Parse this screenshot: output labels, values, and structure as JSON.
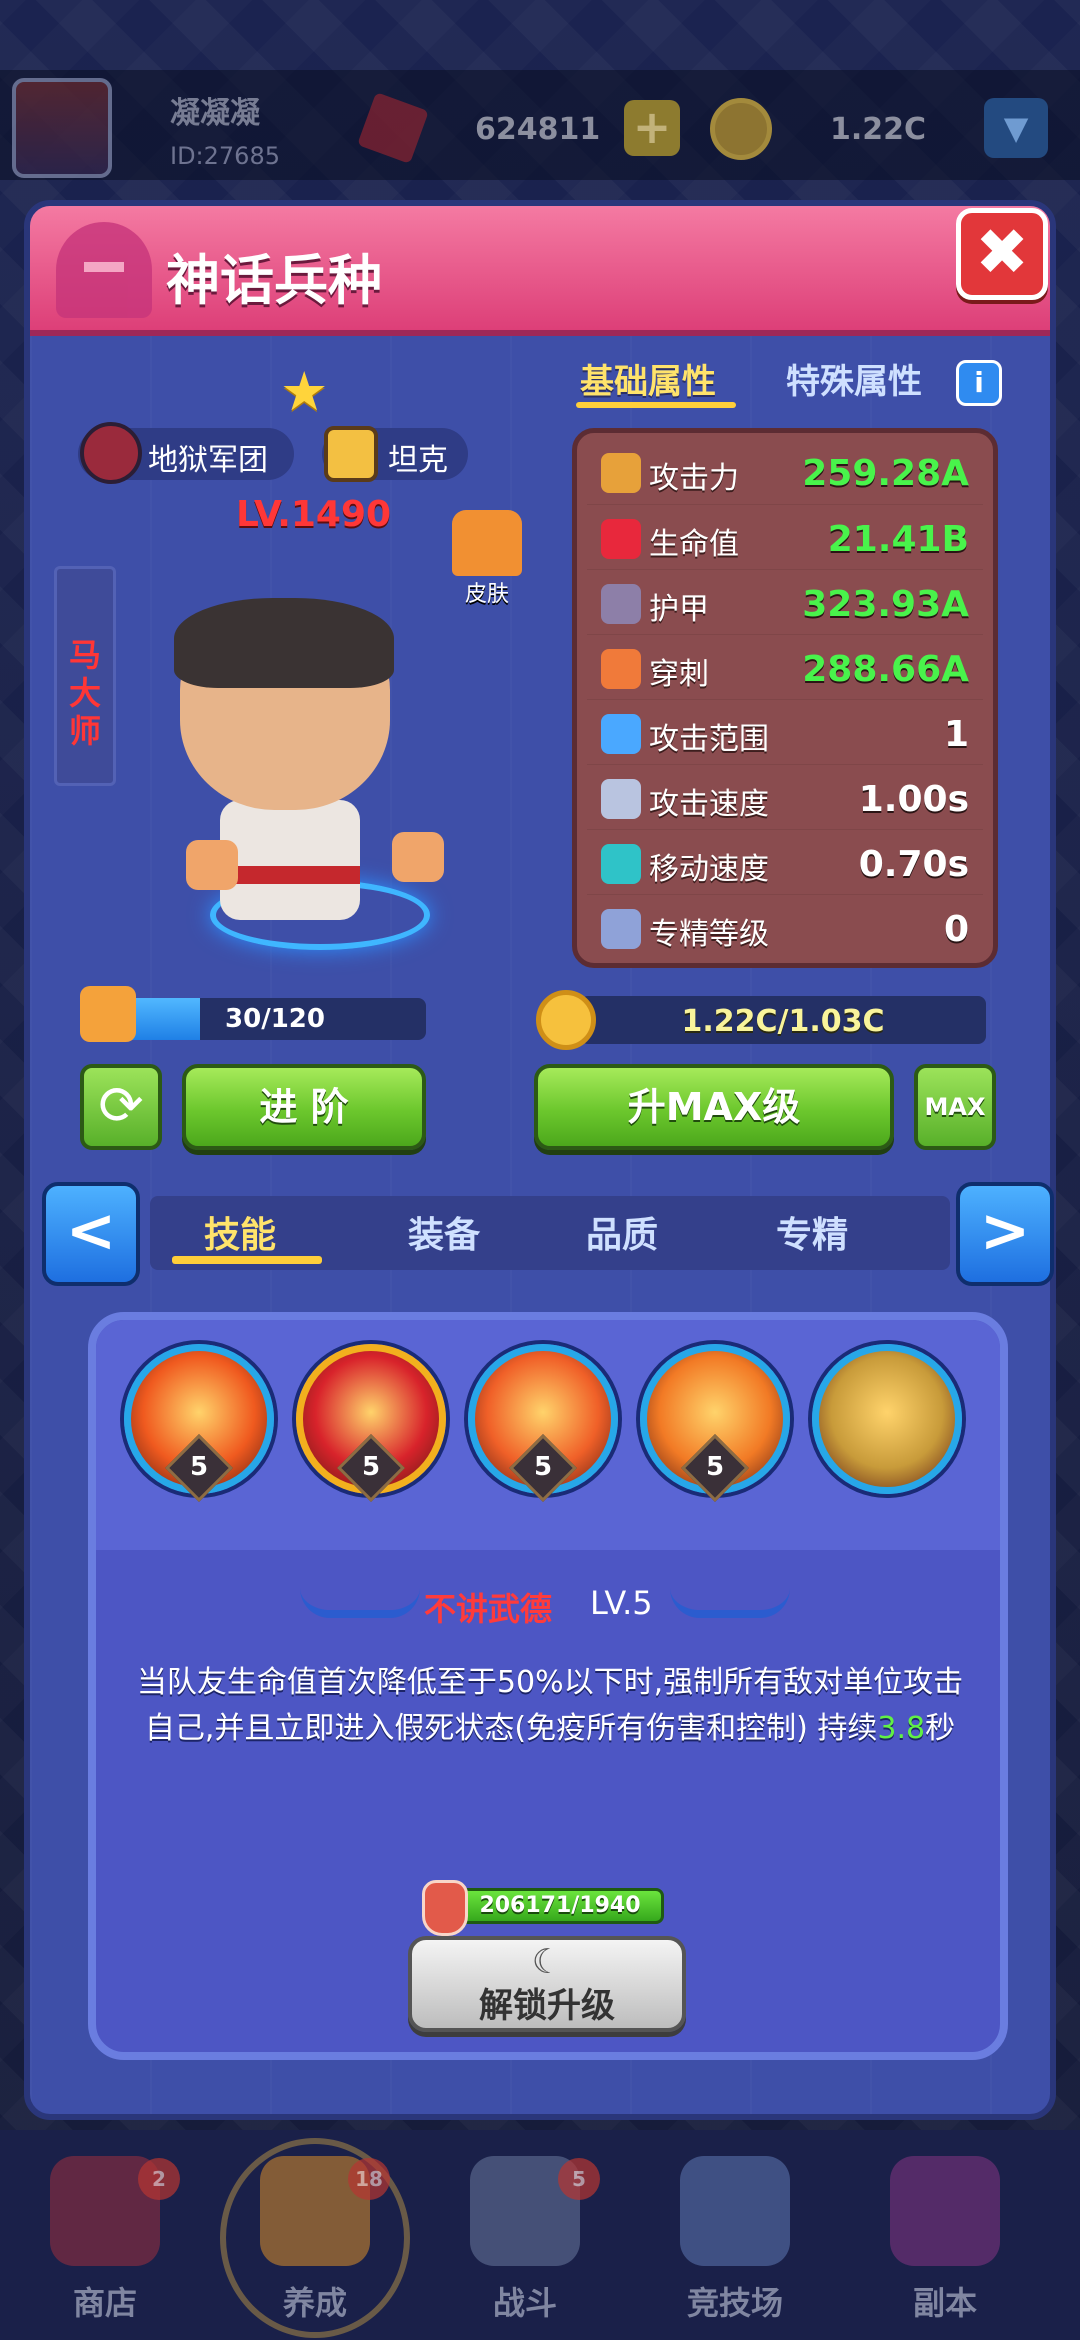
{
  "topbar": {
    "username": "凝凝凝",
    "user_id": "ID:27685",
    "gems": "624811",
    "coins": "1.22C",
    "plus": "+",
    "dropdown": "▼"
  },
  "modal": {
    "title": "神话兵种",
    "close": "✖"
  },
  "hero": {
    "star": "★",
    "faction": "地狱军团",
    "role": "坦克",
    "level": "LV.1490",
    "skin_label": "皮肤",
    "name_vertical": "马大师"
  },
  "stats_tabs": {
    "basic": "基础属性",
    "special": "特殊属性",
    "info": "i"
  },
  "stats": [
    {
      "label": "攻击力",
      "value": "259.28A",
      "color": "#49f34b",
      "icon_color": "#e7a13a",
      "icon": "sword-icon"
    },
    {
      "label": "生命值",
      "value": "21.41B",
      "color": "#49f34b",
      "icon_color": "#e8283c",
      "icon": "heart-icon"
    },
    {
      "label": "护甲",
      "value": "323.93A",
      "color": "#49f34b",
      "icon_color": "#8d7fa8",
      "icon": "armor-icon"
    },
    {
      "label": "穿刺",
      "value": "288.66A",
      "color": "#49f34b",
      "icon_color": "#f07a3a",
      "icon": "pierce-icon"
    },
    {
      "label": "攻击范围",
      "value": "1",
      "color": "#ffffff",
      "icon_color": "#4aa8ff",
      "icon": "range-icon"
    },
    {
      "label": "攻击速度",
      "value": "1.00s",
      "color": "#ffffff",
      "icon_color": "#b9c4e0",
      "icon": "attack-speed-icon"
    },
    {
      "label": "移动速度",
      "value": "0.70s",
      "color": "#ffffff",
      "icon_color": "#2fc3c8",
      "icon": "boot-icon"
    },
    {
      "label": "专精等级",
      "value": "0",
      "color": "#ffffff",
      "icon_color": "#8fa2d8",
      "icon": "mastery-icon"
    }
  ],
  "progress": {
    "shards_text": "30/120",
    "shards_fraction": 0.25,
    "coins_text": "1.22C/1.03C"
  },
  "buttons": {
    "advance": "进 阶",
    "max_upgrade": "升MAX级",
    "max": "MAX"
  },
  "skill_nav": {
    "prev": "<",
    "next": ">",
    "tabs": [
      {
        "label": "技能",
        "active": true
      },
      {
        "label": "装备",
        "active": false
      },
      {
        "label": "品质",
        "active": false
      },
      {
        "label": "专精",
        "active": false
      }
    ]
  },
  "skills": [
    {
      "level": "5",
      "color": "#f05a1f",
      "selected": false
    },
    {
      "level": "5",
      "color": "#d8232b",
      "selected": true
    },
    {
      "level": "5",
      "color": "#f06028",
      "selected": false
    },
    {
      "level": "5",
      "color": "#f27a25",
      "selected": false
    },
    {
      "level": "",
      "color": "#c89b3a",
      "selected": false
    }
  ],
  "skill_detail": {
    "name": "不讲武德",
    "level": "LV.5",
    "desc_line1": "当队友生命值首次降低至于50%以下时,强制所有敌对单位攻击",
    "desc_line2_prefix": "自己,并且立即进入假死状态(免疫所有伤害和控制) 持续",
    "desc_duration": "3.8",
    "desc_suffix": "秒",
    "potion_text": "206171/1940",
    "unlock_icon": "☾",
    "unlock_label": "解锁升级"
  },
  "bottom_nav": [
    {
      "label": "商店",
      "badge": "2",
      "color": "#b8343c"
    },
    {
      "label": "养成",
      "badge": "18",
      "color": "#c9862c"
    },
    {
      "label": "战斗",
      "badge": "5",
      "color": "#7b8bb0"
    },
    {
      "label": "竞技场",
      "badge": "",
      "color": "#6d8cc9"
    },
    {
      "label": "副本",
      "badge": "",
      "color": "#9c3a8e"
    }
  ]
}
